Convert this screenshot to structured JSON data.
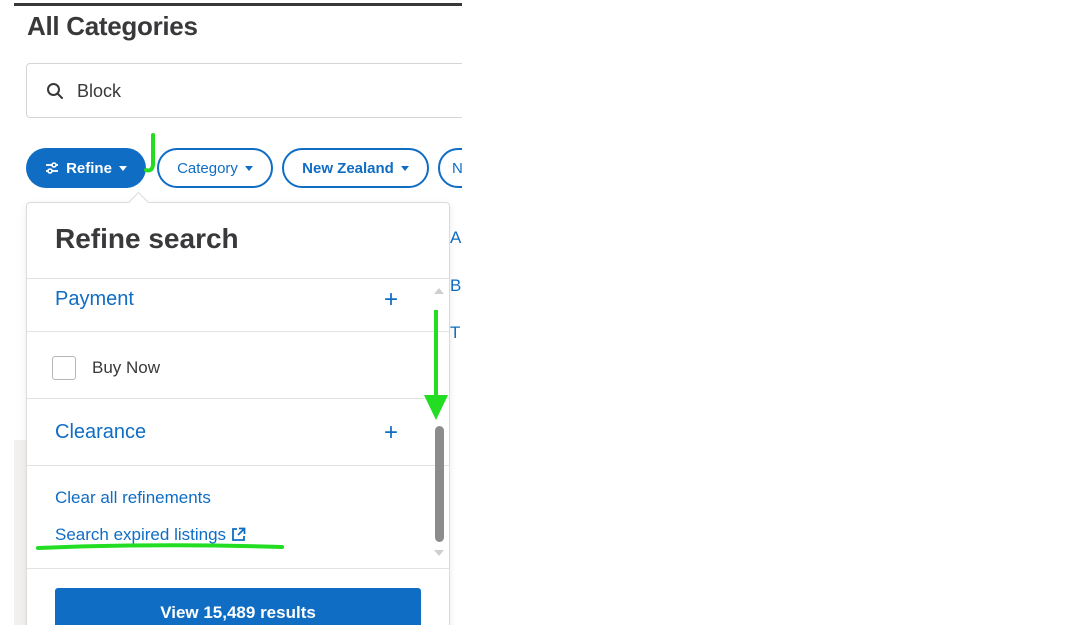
{
  "page": {
    "title": "All Categories"
  },
  "search": {
    "value": "Block",
    "icon": "search-icon"
  },
  "filters": {
    "refine": {
      "label": "Refine",
      "icon": "sliders-icon"
    },
    "category": {
      "label": "Category"
    },
    "region": {
      "label": "New Zealand"
    },
    "more": {
      "label": "N"
    }
  },
  "background_list": [
    "A",
    "B",
    "T"
  ],
  "refine_panel": {
    "title": "Refine search",
    "sections": [
      {
        "label": "Payment",
        "expanded": false
      },
      {
        "label": "Clearance",
        "expanded": false
      }
    ],
    "buy_now": {
      "label": "Buy Now",
      "checked": false
    },
    "clear_all": "Clear all refinements",
    "expired_link": "Search expired listings",
    "results_button": "View 15,489 results"
  },
  "colors": {
    "accent": "#0f6dc4",
    "text": "#39383a",
    "annotation": "#22dd22"
  }
}
